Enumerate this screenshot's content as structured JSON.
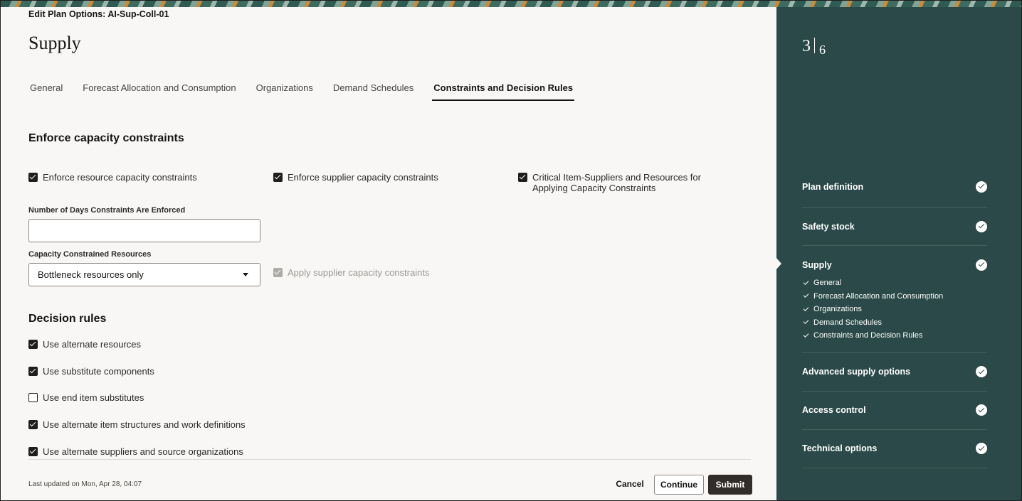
{
  "header": {
    "breadcrumb": "Edit Plan Options: AI-Sup-Coll-01",
    "title": "Supply"
  },
  "tabs": [
    {
      "label": "General",
      "active": false
    },
    {
      "label": "Forecast Allocation and Consumption",
      "active": false
    },
    {
      "label": "Organizations",
      "active": false
    },
    {
      "label": "Demand Schedules",
      "active": false
    },
    {
      "label": "Constraints and Decision Rules",
      "active": true
    }
  ],
  "capacity": {
    "heading": "Enforce capacity constraints",
    "checkboxes": [
      {
        "label": "Enforce resource capacity constraints",
        "checked": true
      },
      {
        "label": "Enforce supplier capacity constraints",
        "checked": true
      },
      {
        "label": "Critical Item-Suppliers and Resources for Applying Capacity Constraints",
        "checked": true
      }
    ],
    "days_label": "Number of Days Constraints Are Enforced",
    "days_value": "",
    "resources_label": "Capacity Constrained Resources",
    "resources_value": "Bottleneck resources only",
    "apply_supplier_label": "Apply supplier capacity constraints",
    "apply_supplier_checked": true,
    "apply_supplier_disabled": true
  },
  "decision": {
    "heading": "Decision rules",
    "checkboxes": [
      {
        "label": "Use alternate resources",
        "checked": true
      },
      {
        "label": "Use substitute components",
        "checked": true
      },
      {
        "label": "Use end item substitutes",
        "checked": false
      },
      {
        "label": "Use alternate item structures and work definitions",
        "checked": true
      },
      {
        "label": "Use alternate suppliers and source organizations",
        "checked": true
      }
    ]
  },
  "footer": {
    "last_updated": "Last updated on Mon, Apr 28, 04:07",
    "cancel": "Cancel",
    "continue": "Continue",
    "submit": "Submit"
  },
  "sidebar": {
    "current_step": "3",
    "total_steps": "6",
    "steps": [
      {
        "label": "Plan definition",
        "done": true
      },
      {
        "label": "Safety stock",
        "done": true
      },
      {
        "label": "Supply",
        "done": true,
        "current": true,
        "substeps": [
          "General",
          "Forecast Allocation and Consumption",
          "Organizations",
          "Demand Schedules",
          "Constraints and Decision Rules"
        ]
      },
      {
        "label": "Advanced supply options",
        "done": true
      },
      {
        "label": "Access control",
        "done": true
      },
      {
        "label": "Technical options",
        "done": true
      }
    ]
  },
  "colors": {
    "sidebar_bg": "#2a4948",
    "page_bg": "#f9f7f5",
    "primary_button": "#312d2a"
  }
}
